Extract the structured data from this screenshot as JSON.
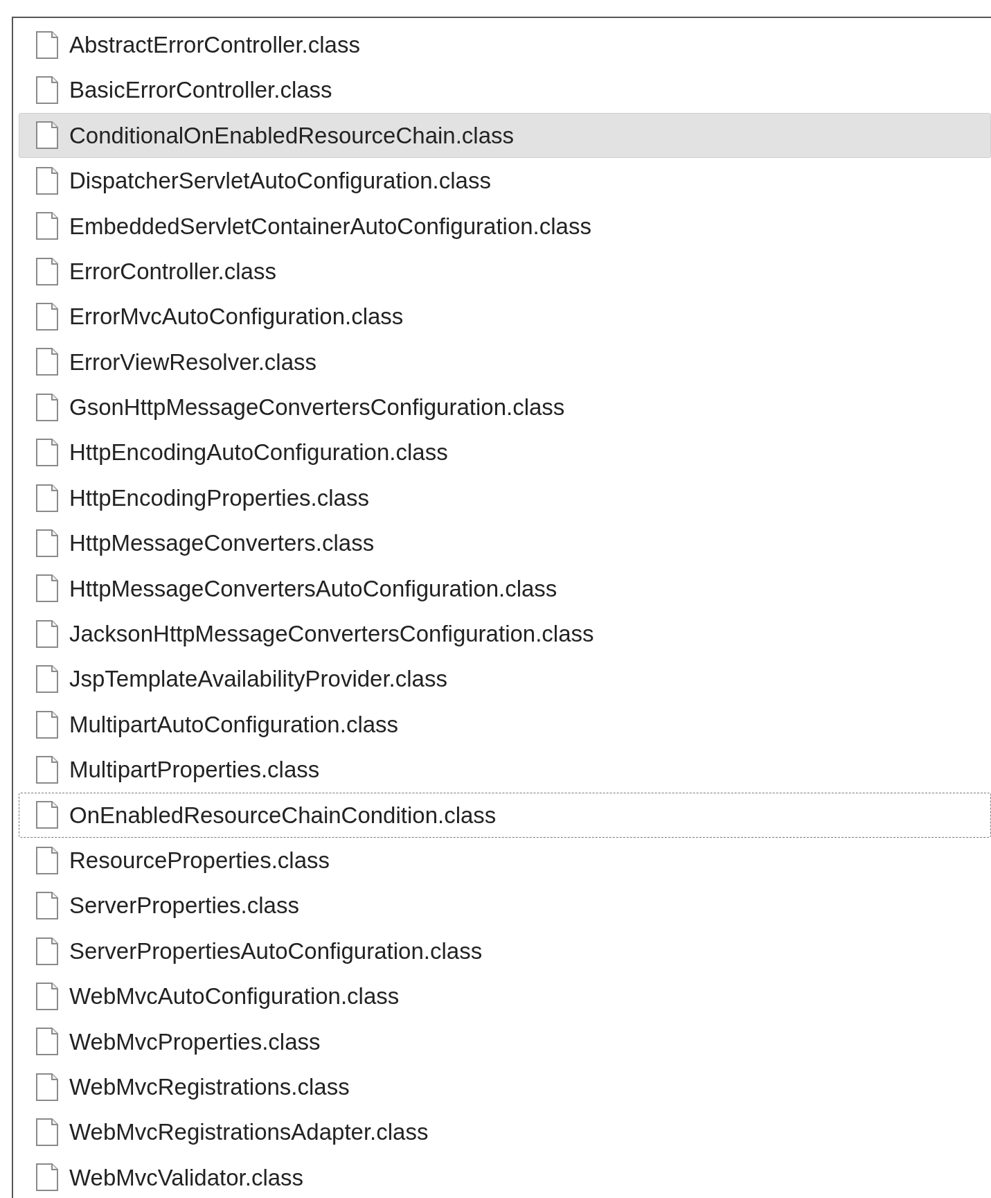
{
  "files": [
    {
      "name": "AbstractErrorController.class",
      "selected": false,
      "focused": false
    },
    {
      "name": "BasicErrorController.class",
      "selected": false,
      "focused": false
    },
    {
      "name": "ConditionalOnEnabledResourceChain.class",
      "selected": true,
      "focused": false
    },
    {
      "name": "DispatcherServletAutoConfiguration.class",
      "selected": false,
      "focused": false
    },
    {
      "name": "EmbeddedServletContainerAutoConfiguration.class",
      "selected": false,
      "focused": false
    },
    {
      "name": "ErrorController.class",
      "selected": false,
      "focused": false
    },
    {
      "name": "ErrorMvcAutoConfiguration.class",
      "selected": false,
      "focused": false
    },
    {
      "name": "ErrorViewResolver.class",
      "selected": false,
      "focused": false
    },
    {
      "name": "GsonHttpMessageConvertersConfiguration.class",
      "selected": false,
      "focused": false
    },
    {
      "name": "HttpEncodingAutoConfiguration.class",
      "selected": false,
      "focused": false
    },
    {
      "name": "HttpEncodingProperties.class",
      "selected": false,
      "focused": false
    },
    {
      "name": "HttpMessageConverters.class",
      "selected": false,
      "focused": false
    },
    {
      "name": "HttpMessageConvertersAutoConfiguration.class",
      "selected": false,
      "focused": false
    },
    {
      "name": "JacksonHttpMessageConvertersConfiguration.class",
      "selected": false,
      "focused": false
    },
    {
      "name": "JspTemplateAvailabilityProvider.class",
      "selected": false,
      "focused": false
    },
    {
      "name": "MultipartAutoConfiguration.class",
      "selected": false,
      "focused": false
    },
    {
      "name": "MultipartProperties.class",
      "selected": false,
      "focused": false
    },
    {
      "name": "OnEnabledResourceChainCondition.class",
      "selected": false,
      "focused": true
    },
    {
      "name": "ResourceProperties.class",
      "selected": false,
      "focused": false
    },
    {
      "name": "ServerProperties.class",
      "selected": false,
      "focused": false
    },
    {
      "name": "ServerPropertiesAutoConfiguration.class",
      "selected": false,
      "focused": false
    },
    {
      "name": "WebMvcAutoConfiguration.class",
      "selected": false,
      "focused": false
    },
    {
      "name": "WebMvcProperties.class",
      "selected": false,
      "focused": false
    },
    {
      "name": "WebMvcRegistrations.class",
      "selected": false,
      "focused": false
    },
    {
      "name": "WebMvcRegistrationsAdapter.class",
      "selected": false,
      "focused": false
    },
    {
      "name": "WebMvcValidator.class",
      "selected": false,
      "focused": false
    }
  ]
}
